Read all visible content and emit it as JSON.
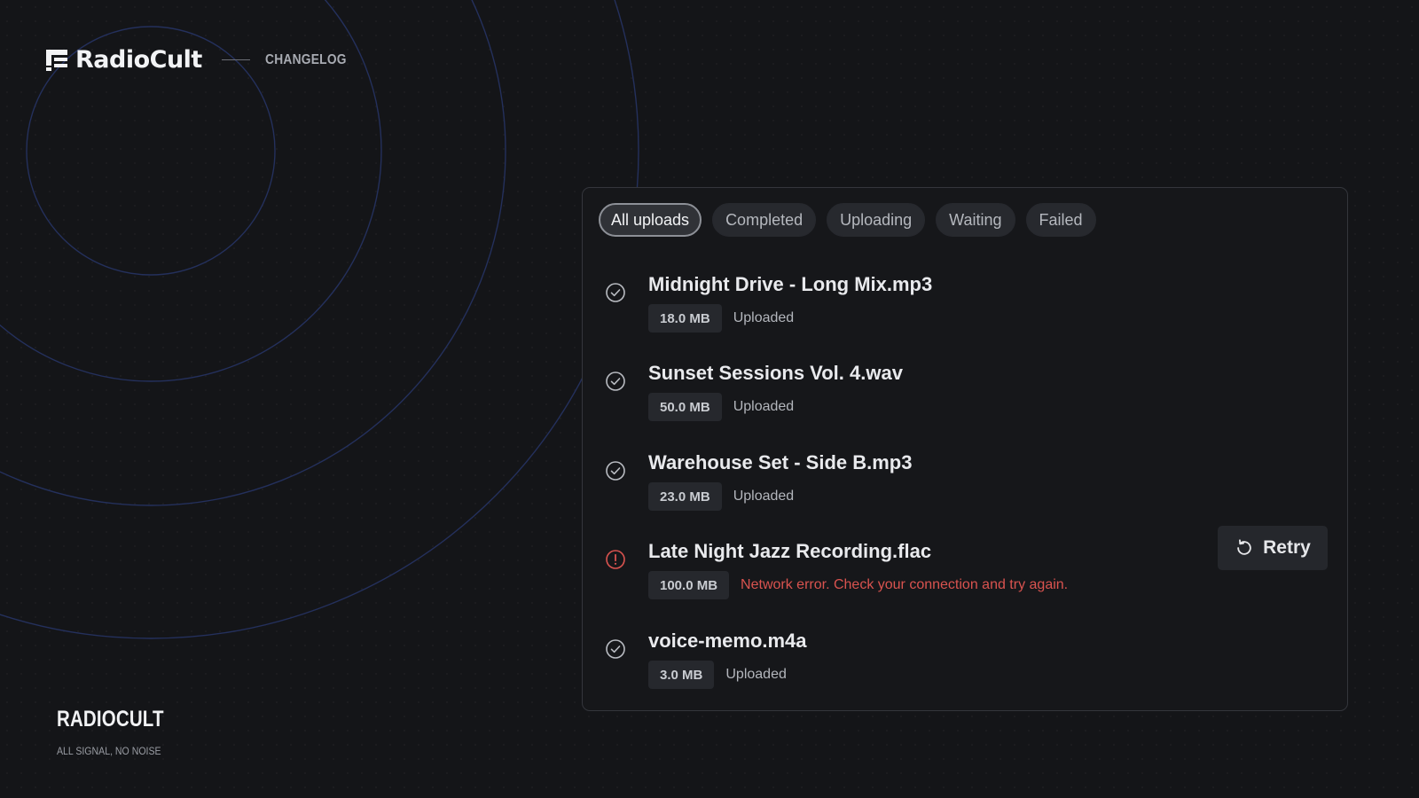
{
  "brand": {
    "name": "RadioCult",
    "section": "CHANGELOG",
    "logo_icon": "radiocult-logo-icon"
  },
  "footer": {
    "name": "RADIOCULT",
    "tagline": "ALL SIGNAL, NO NOISE"
  },
  "tabs": [
    {
      "label": "All uploads",
      "active": true
    },
    {
      "label": "Completed",
      "active": false
    },
    {
      "label": "Uploading",
      "active": false
    },
    {
      "label": "Waiting",
      "active": false
    },
    {
      "label": "Failed",
      "active": false
    }
  ],
  "uploads": [
    {
      "name": "Midnight Drive - Long Mix.mp3",
      "size": "18.0 MB",
      "status": "Uploaded",
      "state": "success",
      "icon": "check-circle-icon"
    },
    {
      "name": "Sunset Sessions Vol. 4.wav",
      "size": "50.0 MB",
      "status": "Uploaded",
      "state": "success",
      "icon": "check-circle-icon"
    },
    {
      "name": "Warehouse Set - Side B.mp3",
      "size": "23.0 MB",
      "status": "Uploaded",
      "state": "success",
      "icon": "check-circle-icon"
    },
    {
      "name": "Late Night Jazz Recording.flac",
      "size": "100.0 MB",
      "status": "Network error. Check your connection and try again.",
      "state": "error",
      "icon": "error-circle-icon",
      "action": "Retry",
      "action_icon": "retry-icon"
    },
    {
      "name": "voice-memo.m4a",
      "size": "3.0 MB",
      "status": "Uploaded",
      "state": "success",
      "icon": "check-circle-icon"
    }
  ],
  "colors": {
    "background": "#141518",
    "panel": "#16171a",
    "ring": "#26305a",
    "error": "#d9534f"
  }
}
